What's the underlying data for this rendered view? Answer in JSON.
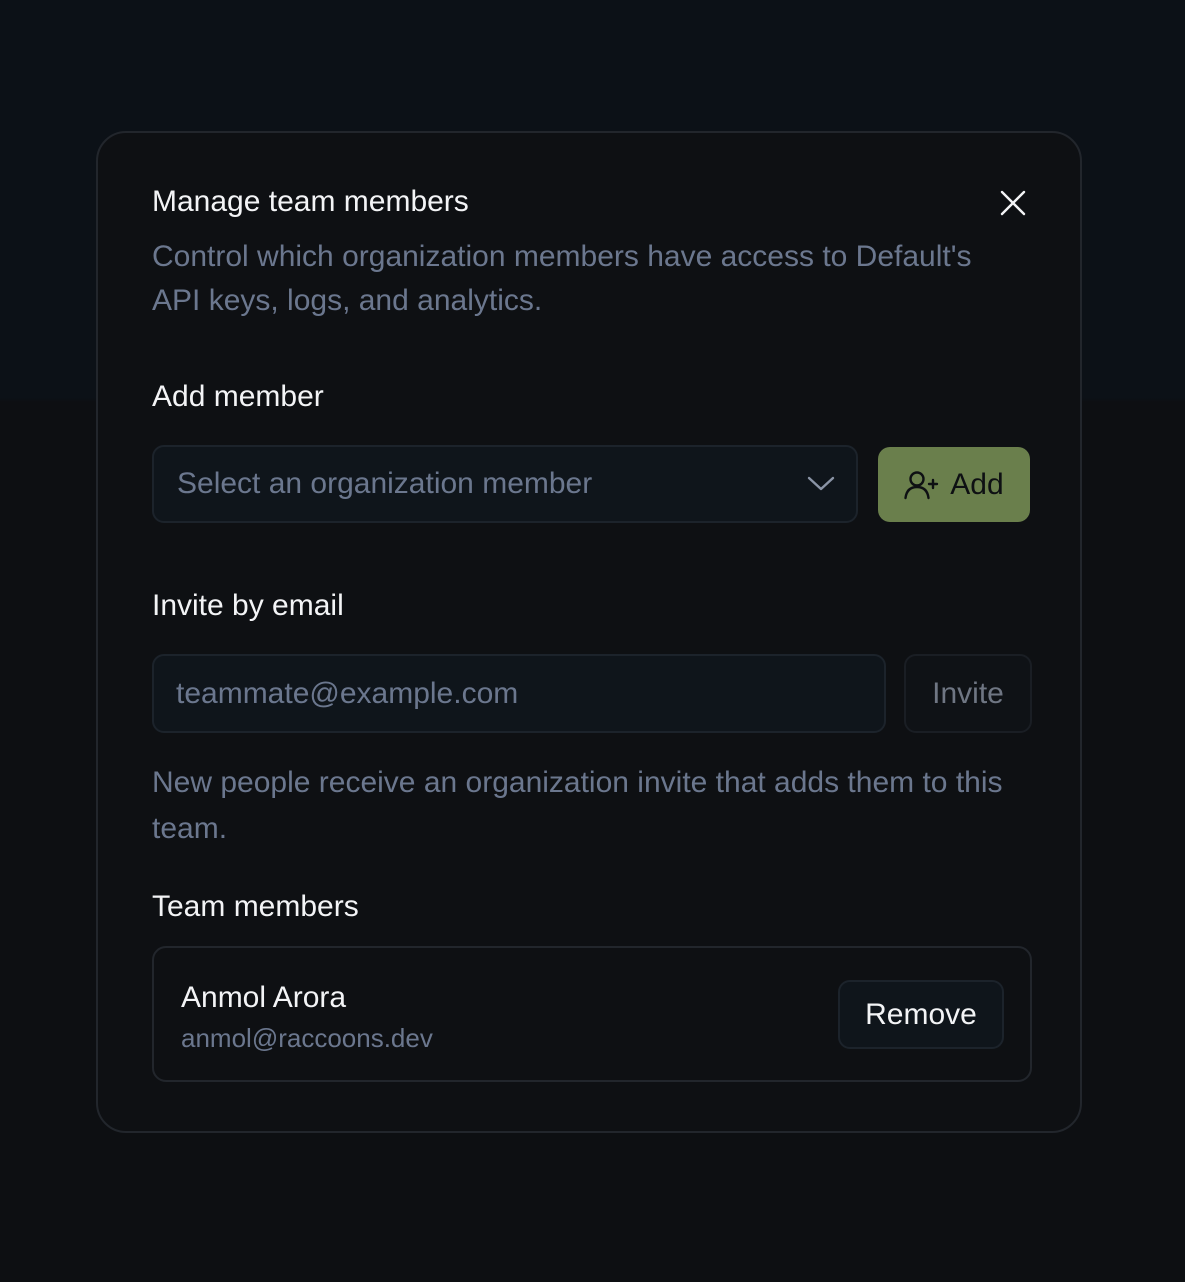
{
  "dialog": {
    "title": "Manage team members",
    "description": "Control which organization members have access to Default's API keys, logs, and analytics.",
    "close_icon": "close-icon"
  },
  "add_member": {
    "label": "Add member",
    "select_placeholder": "Select an organization member",
    "select_icon": "chevron-down-icon",
    "add_button_label": "Add",
    "add_button_icon": "user-plus-icon",
    "add_button_color": "#6a7f4c"
  },
  "invite": {
    "label": "Invite by email",
    "email_value": "",
    "email_placeholder": "teammate@example.com",
    "invite_button_label": "Invite",
    "hint": "New people receive an organization invite that adds them to this team."
  },
  "team_members": {
    "label": "Team members",
    "members": [
      {
        "name": "Anmol Arora",
        "email": "anmol@raccoons.dev",
        "remove_label": "Remove"
      }
    ]
  }
}
